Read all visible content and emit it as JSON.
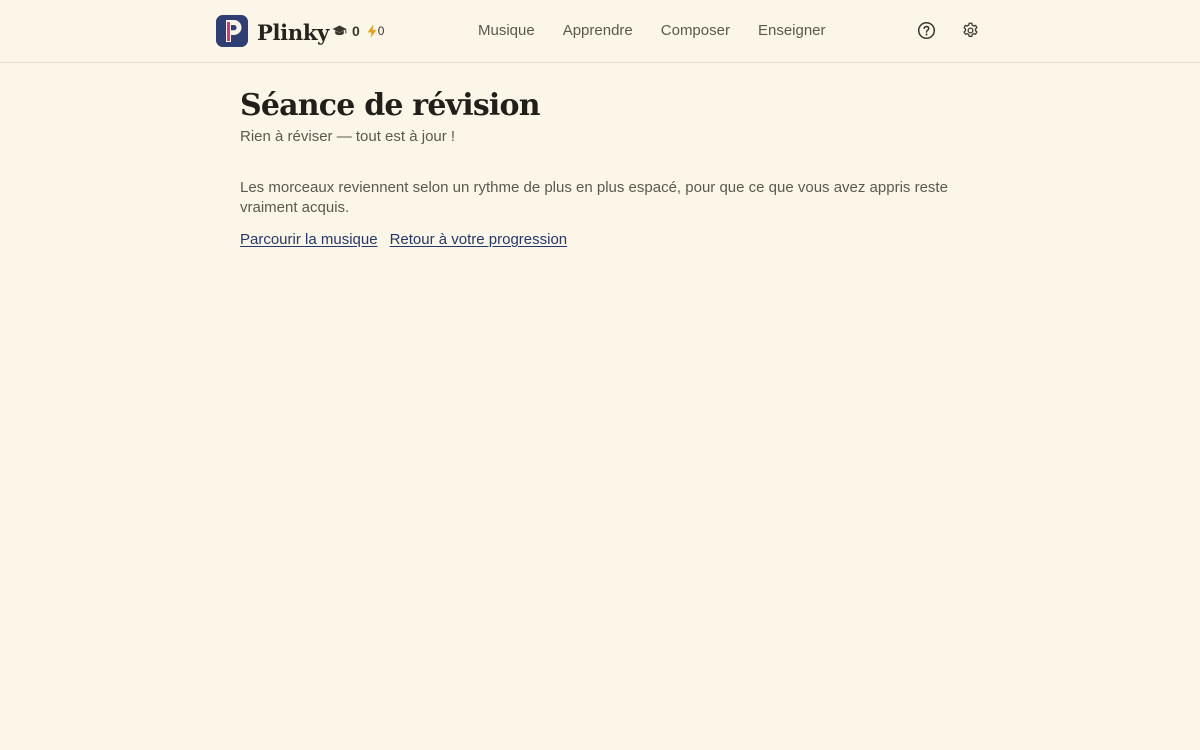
{
  "brand": {
    "name": "Plinky",
    "logo_letter": "P",
    "logo_color": "#2f3e73",
    "logo_accent": "#d8377a"
  },
  "stats": {
    "level_icon": "graduation-cap-icon",
    "level_value": "0",
    "streak_icon": "lightning-bolt-icon",
    "streak_value": "0"
  },
  "nav": {
    "items": [
      {
        "label": "Musique"
      },
      {
        "label": "Apprendre"
      },
      {
        "label": "Composer"
      },
      {
        "label": "Enseigner"
      }
    ]
  },
  "toolbar": {
    "help_icon": "help-circle-icon",
    "settings_icon": "gear-icon"
  },
  "main": {
    "title": "Séance de révision",
    "subtitle": "Rien à réviser — tout est à jour !",
    "explanation": "Les morceaux reviennent selon un rythme de plus en plus espacé, pour que ce que vous avez appris reste vraiment acquis.",
    "links": [
      {
        "label": "Parcourir la musique"
      },
      {
        "label": "Retour à votre progression"
      }
    ]
  },
  "colors": {
    "background": "#fcf6e9",
    "link": "#26386a",
    "muted_text": "#5d584e",
    "heading": "#221f1a",
    "divider": "#e6dfcf"
  }
}
